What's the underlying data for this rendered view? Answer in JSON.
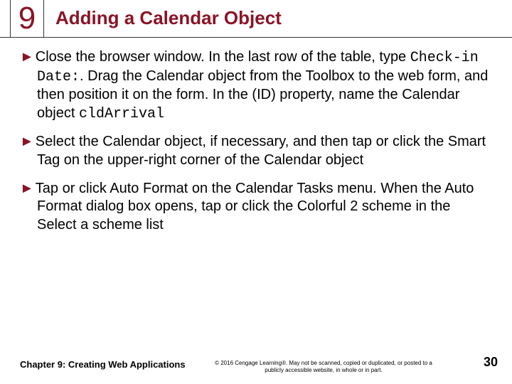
{
  "chapterNumber": "9",
  "title": "Adding a Calendar Object",
  "arrow": "►",
  "step1": {
    "lead": "Close the browser window. In the last row of the table, type ",
    "code1": "Check-in Date:",
    "mid": ". Drag the Calendar object from the Toolbox to the web form, and then position it on the form. In the (ID) property, name the Calendar object ",
    "code2": "cldArrival"
  },
  "step2": "Select the Calendar object, if necessary, and then tap or click the Smart Tag on the upper-right corner of the Calendar object",
  "step3": "Tap or click Auto Format on the Calendar Tasks menu. When the Auto Format dialog box opens, tap or click the Colorful 2 scheme in the Select a scheme list",
  "footerLeft": "Chapter 9: Creating Web Applications",
  "footerCenter": "© 2016 Cengage Learning®. May not be scanned, copied or duplicated, or posted to a publicly accessible website, in whole or in part.",
  "pageNumber": "30"
}
